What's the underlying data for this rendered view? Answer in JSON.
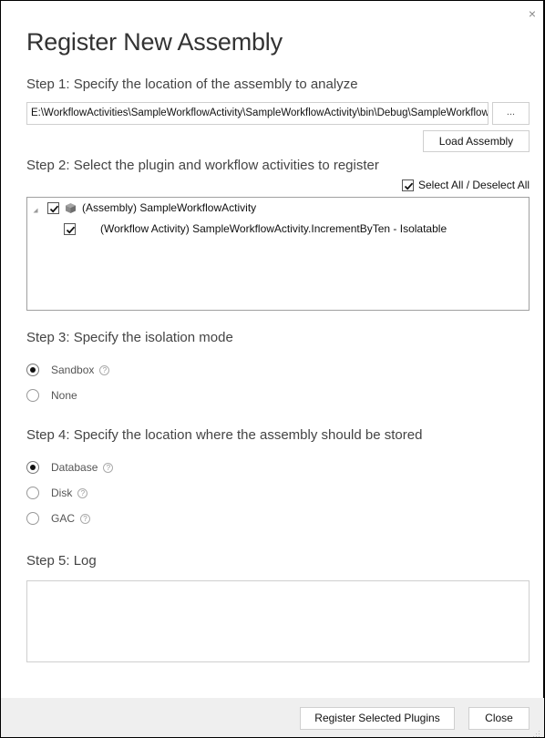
{
  "window": {
    "title": "Register New Assembly",
    "close_icon": "close-x-icon"
  },
  "step1": {
    "label": "Step 1: Specify the location of the assembly to analyze",
    "path_value": "E:\\WorkflowActivities\\SampleWorkflowActivity\\SampleWorkflowActivity\\bin\\Debug\\SampleWorkflowActivity.dll",
    "browse_label": "...",
    "load_label": "Load Assembly"
  },
  "step2": {
    "label": "Step 2: Select the plugin and workflow activities to register",
    "select_all_label": "Select All / Deselect All",
    "select_all_checked": true,
    "tree": [
      {
        "text": "(Assembly) SampleWorkflowActivity",
        "checked": true,
        "expanded": true,
        "icon": "assembly-package-icon"
      },
      {
        "text": "(Workflow Activity) SampleWorkflowActivity.IncrementByTen - Isolatable",
        "checked": true
      }
    ]
  },
  "step3": {
    "label": "Step 3: Specify the isolation mode",
    "options": [
      {
        "label": "Sandbox",
        "checked": true,
        "help": true
      },
      {
        "label": "None",
        "checked": false,
        "help": false
      }
    ]
  },
  "step4": {
    "label": "Step 4: Specify the location where the assembly should be stored",
    "options": [
      {
        "label": "Database",
        "checked": true,
        "help": true
      },
      {
        "label": "Disk",
        "checked": false,
        "help": true
      },
      {
        "label": "GAC",
        "checked": false,
        "help": true
      }
    ]
  },
  "step5": {
    "label": "Step 5: Log",
    "log_text": ""
  },
  "footer": {
    "register_label": "Register Selected Plugins",
    "close_label": "Close"
  },
  "help_glyph": "?",
  "close_glyph": "×"
}
